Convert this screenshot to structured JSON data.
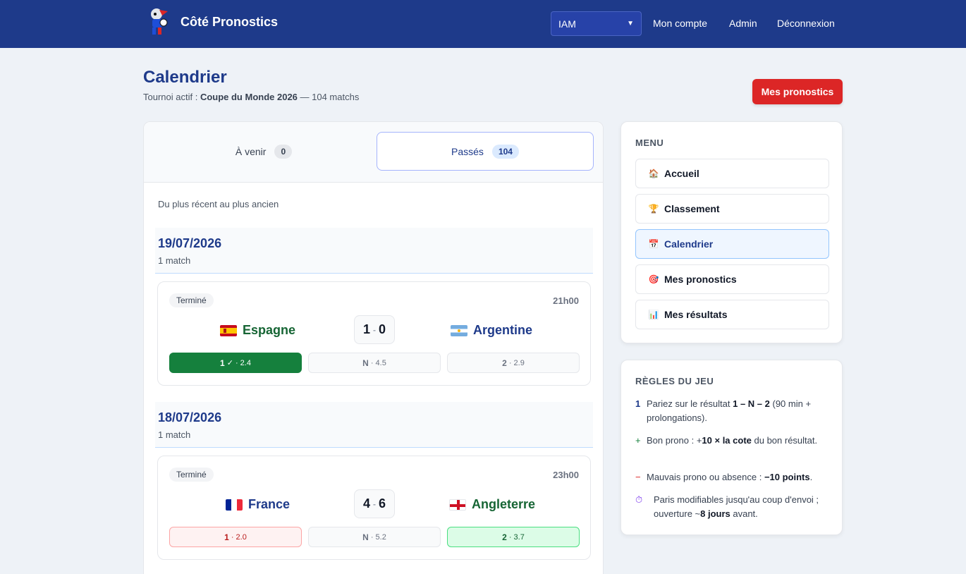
{
  "header": {
    "brand": "Côté Pronostics",
    "tenant_selected": "IAM",
    "nav": [
      "Mon compte",
      "Admin",
      "Déconnexion"
    ]
  },
  "page": {
    "title": "Calendrier",
    "subtitle_prefix": "Tournoi actif : ",
    "tournament": "Coupe du Monde 2026",
    "subtitle_suffix": " — 104 matchs",
    "primary_button": "Mes pronostics"
  },
  "tabs": [
    {
      "label": "À venir",
      "count": "0",
      "active": false
    },
    {
      "label": "Passés",
      "count": "104",
      "active": true
    }
  ],
  "order_note": "Du plus récent au plus ancien",
  "groups": [
    {
      "date": "19/07/2026",
      "count": "1 match",
      "match": {
        "status": "Terminé",
        "time": "21h00",
        "home": "Espagne",
        "away": "Argentine",
        "home_score": "1",
        "away_score": "0",
        "odds": [
          {
            "label": "1",
            "extra": "✓ · 2.4"
          },
          {
            "label": "N",
            "extra": "· 4.5"
          },
          {
            "label": "2",
            "extra": "· 2.9"
          }
        ]
      }
    },
    {
      "date": "18/07/2026",
      "count": "1 match",
      "match": {
        "status": "Terminé",
        "time": "23h00",
        "home": "France",
        "away": "Angleterre",
        "home_score": "4",
        "away_score": "6",
        "odds": [
          {
            "label": "1",
            "extra": "· 2.0"
          },
          {
            "label": "N",
            "extra": "· 5.2"
          },
          {
            "label": "2",
            "extra": "· 3.7"
          }
        ]
      }
    }
  ],
  "sidebar": {
    "menu_title": "MENU",
    "menu": [
      "Accueil",
      "Classement",
      "Calendrier",
      "Mes pronostics",
      "Mes résultats"
    ],
    "rules_title": "RÈGLES DU JEU",
    "rules": [
      {
        "mark": "1",
        "t1": "Pariez sur le résultat ",
        "b1": "1 – N – 2",
        "t2": " (90 min + prolongations)."
      },
      {
        "mark": "+",
        "t1": "Bon prono : +",
        "b1": "10 × la cote",
        "t2": " du bon résultat."
      },
      {
        "mark": "−",
        "t1": "Mauvais prono ou absence : ",
        "b1": "−10 points",
        "t2": "."
      },
      {
        "mark": "⏱",
        "t1": "Paris modifiables jusqu'au coup d'envoi ; ouverture ~",
        "b1": "8 jours",
        "t2": " avant."
      }
    ]
  },
  "colors": {
    "primary": "#1e3a8a",
    "accent": "#dc2626",
    "success": "#15803d"
  }
}
